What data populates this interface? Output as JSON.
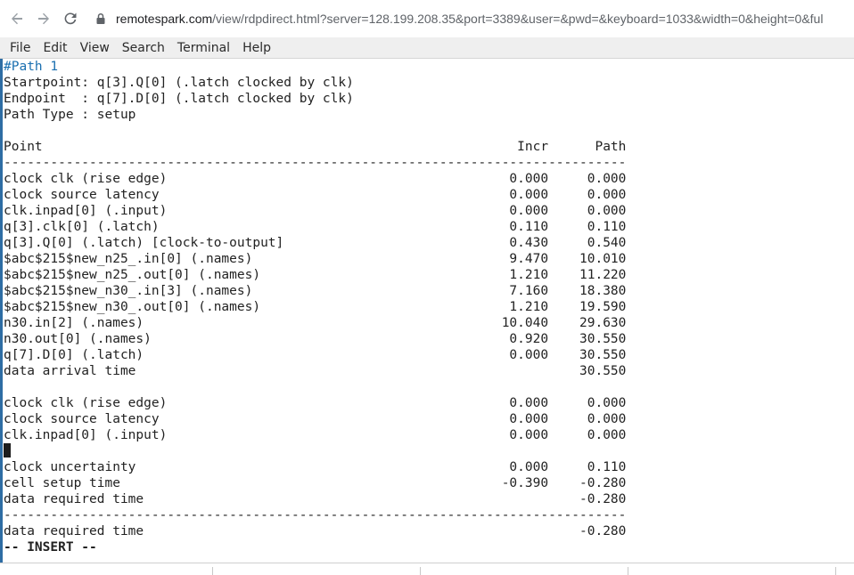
{
  "browser": {
    "url_host": "remotespark.com",
    "url_rest": "/view/rdpdirect.html?server=128.199.208.35&port=3389&user=&pwd=&keyboard=1033&width=0&height=0&ful"
  },
  "menu": {
    "items": [
      "File",
      "Edit",
      "View",
      "Search",
      "Terminal",
      "Help"
    ]
  },
  "terminal": {
    "lines": [
      "#Path 1",
      "Startpoint: q[3].Q[0] (.latch clocked by clk)",
      "Endpoint  : q[7].D[0] (.latch clocked by clk)",
      "Path Type : setup",
      "",
      "Point                                                             Incr      Path",
      "--------------------------------------------------------------------------------",
      "clock clk (rise edge)                                            0.000     0.000",
      "clock source latency                                             0.000     0.000",
      "clk.inpad[0] (.input)                                            0.000     0.000",
      "q[3].clk[0] (.latch)                                             0.110     0.110",
      "q[3].Q[0] (.latch) [clock-to-output]                             0.430     0.540",
      "$abc$215$new_n25_.in[0] (.names)                                 9.470    10.010",
      "$abc$215$new_n25_.out[0] (.names)                                1.210    11.220",
      "$abc$215$new_n30_.in[3] (.names)                                 7.160    18.380",
      "$abc$215$new_n30_.out[0] (.names)                                1.210    19.590",
      "n30.in[2] (.names)                                              10.040    29.630",
      "n30.out[0] (.names)                                              0.920    30.550",
      "q[7].D[0] (.latch)                                               0.000    30.550",
      "data arrival time                                                         30.550",
      "",
      "clock clk (rise edge)                                            0.000     0.000",
      "clock source latency                                             0.000     0.000",
      "clk.inpad[0] (.input)                                            0.000     0.000",
      "",
      "clock uncertainty                                                0.000     0.110",
      "cell setup time                                                 -0.390    -0.280",
      "data required time                                                        -0.280",
      "--------------------------------------------------------------------------------",
      "data required time                                                        -0.280",
      "-- INSERT --"
    ]
  }
}
